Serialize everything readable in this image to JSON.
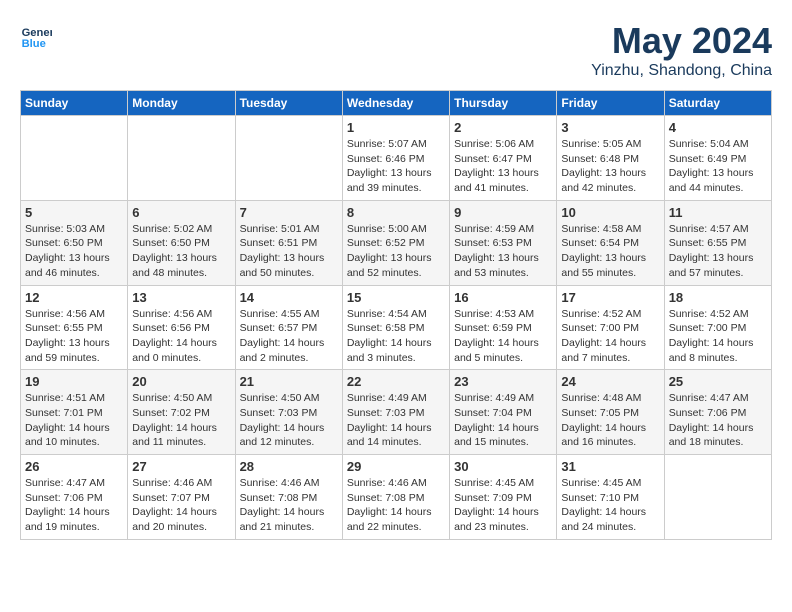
{
  "header": {
    "logo_line1": "General",
    "logo_line2": "Blue",
    "title": "May 2024",
    "subtitle": "Yinzhu, Shandong, China"
  },
  "weekdays": [
    "Sunday",
    "Monday",
    "Tuesday",
    "Wednesday",
    "Thursday",
    "Friday",
    "Saturday"
  ],
  "weeks": [
    [
      {
        "day": "",
        "info": ""
      },
      {
        "day": "",
        "info": ""
      },
      {
        "day": "",
        "info": ""
      },
      {
        "day": "1",
        "info": "Sunrise: 5:07 AM\nSunset: 6:46 PM\nDaylight: 13 hours\nand 39 minutes."
      },
      {
        "day": "2",
        "info": "Sunrise: 5:06 AM\nSunset: 6:47 PM\nDaylight: 13 hours\nand 41 minutes."
      },
      {
        "day": "3",
        "info": "Sunrise: 5:05 AM\nSunset: 6:48 PM\nDaylight: 13 hours\nand 42 minutes."
      },
      {
        "day": "4",
        "info": "Sunrise: 5:04 AM\nSunset: 6:49 PM\nDaylight: 13 hours\nand 44 minutes."
      }
    ],
    [
      {
        "day": "5",
        "info": "Sunrise: 5:03 AM\nSunset: 6:50 PM\nDaylight: 13 hours\nand 46 minutes."
      },
      {
        "day": "6",
        "info": "Sunrise: 5:02 AM\nSunset: 6:50 PM\nDaylight: 13 hours\nand 48 minutes."
      },
      {
        "day": "7",
        "info": "Sunrise: 5:01 AM\nSunset: 6:51 PM\nDaylight: 13 hours\nand 50 minutes."
      },
      {
        "day": "8",
        "info": "Sunrise: 5:00 AM\nSunset: 6:52 PM\nDaylight: 13 hours\nand 52 minutes."
      },
      {
        "day": "9",
        "info": "Sunrise: 4:59 AM\nSunset: 6:53 PM\nDaylight: 13 hours\nand 53 minutes."
      },
      {
        "day": "10",
        "info": "Sunrise: 4:58 AM\nSunset: 6:54 PM\nDaylight: 13 hours\nand 55 minutes."
      },
      {
        "day": "11",
        "info": "Sunrise: 4:57 AM\nSunset: 6:55 PM\nDaylight: 13 hours\nand 57 minutes."
      }
    ],
    [
      {
        "day": "12",
        "info": "Sunrise: 4:56 AM\nSunset: 6:55 PM\nDaylight: 13 hours\nand 59 minutes."
      },
      {
        "day": "13",
        "info": "Sunrise: 4:56 AM\nSunset: 6:56 PM\nDaylight: 14 hours\nand 0 minutes."
      },
      {
        "day": "14",
        "info": "Sunrise: 4:55 AM\nSunset: 6:57 PM\nDaylight: 14 hours\nand 2 minutes."
      },
      {
        "day": "15",
        "info": "Sunrise: 4:54 AM\nSunset: 6:58 PM\nDaylight: 14 hours\nand 3 minutes."
      },
      {
        "day": "16",
        "info": "Sunrise: 4:53 AM\nSunset: 6:59 PM\nDaylight: 14 hours\nand 5 minutes."
      },
      {
        "day": "17",
        "info": "Sunrise: 4:52 AM\nSunset: 7:00 PM\nDaylight: 14 hours\nand 7 minutes."
      },
      {
        "day": "18",
        "info": "Sunrise: 4:52 AM\nSunset: 7:00 PM\nDaylight: 14 hours\nand 8 minutes."
      }
    ],
    [
      {
        "day": "19",
        "info": "Sunrise: 4:51 AM\nSunset: 7:01 PM\nDaylight: 14 hours\nand 10 minutes."
      },
      {
        "day": "20",
        "info": "Sunrise: 4:50 AM\nSunset: 7:02 PM\nDaylight: 14 hours\nand 11 minutes."
      },
      {
        "day": "21",
        "info": "Sunrise: 4:50 AM\nSunset: 7:03 PM\nDaylight: 14 hours\nand 12 minutes."
      },
      {
        "day": "22",
        "info": "Sunrise: 4:49 AM\nSunset: 7:03 PM\nDaylight: 14 hours\nand 14 minutes."
      },
      {
        "day": "23",
        "info": "Sunrise: 4:49 AM\nSunset: 7:04 PM\nDaylight: 14 hours\nand 15 minutes."
      },
      {
        "day": "24",
        "info": "Sunrise: 4:48 AM\nSunset: 7:05 PM\nDaylight: 14 hours\nand 16 minutes."
      },
      {
        "day": "25",
        "info": "Sunrise: 4:47 AM\nSunset: 7:06 PM\nDaylight: 14 hours\nand 18 minutes."
      }
    ],
    [
      {
        "day": "26",
        "info": "Sunrise: 4:47 AM\nSunset: 7:06 PM\nDaylight: 14 hours\nand 19 minutes."
      },
      {
        "day": "27",
        "info": "Sunrise: 4:46 AM\nSunset: 7:07 PM\nDaylight: 14 hours\nand 20 minutes."
      },
      {
        "day": "28",
        "info": "Sunrise: 4:46 AM\nSunset: 7:08 PM\nDaylight: 14 hours\nand 21 minutes."
      },
      {
        "day": "29",
        "info": "Sunrise: 4:46 AM\nSunset: 7:08 PM\nDaylight: 14 hours\nand 22 minutes."
      },
      {
        "day": "30",
        "info": "Sunrise: 4:45 AM\nSunset: 7:09 PM\nDaylight: 14 hours\nand 23 minutes."
      },
      {
        "day": "31",
        "info": "Sunrise: 4:45 AM\nSunset: 7:10 PM\nDaylight: 14 hours\nand 24 minutes."
      },
      {
        "day": "",
        "info": ""
      }
    ]
  ]
}
